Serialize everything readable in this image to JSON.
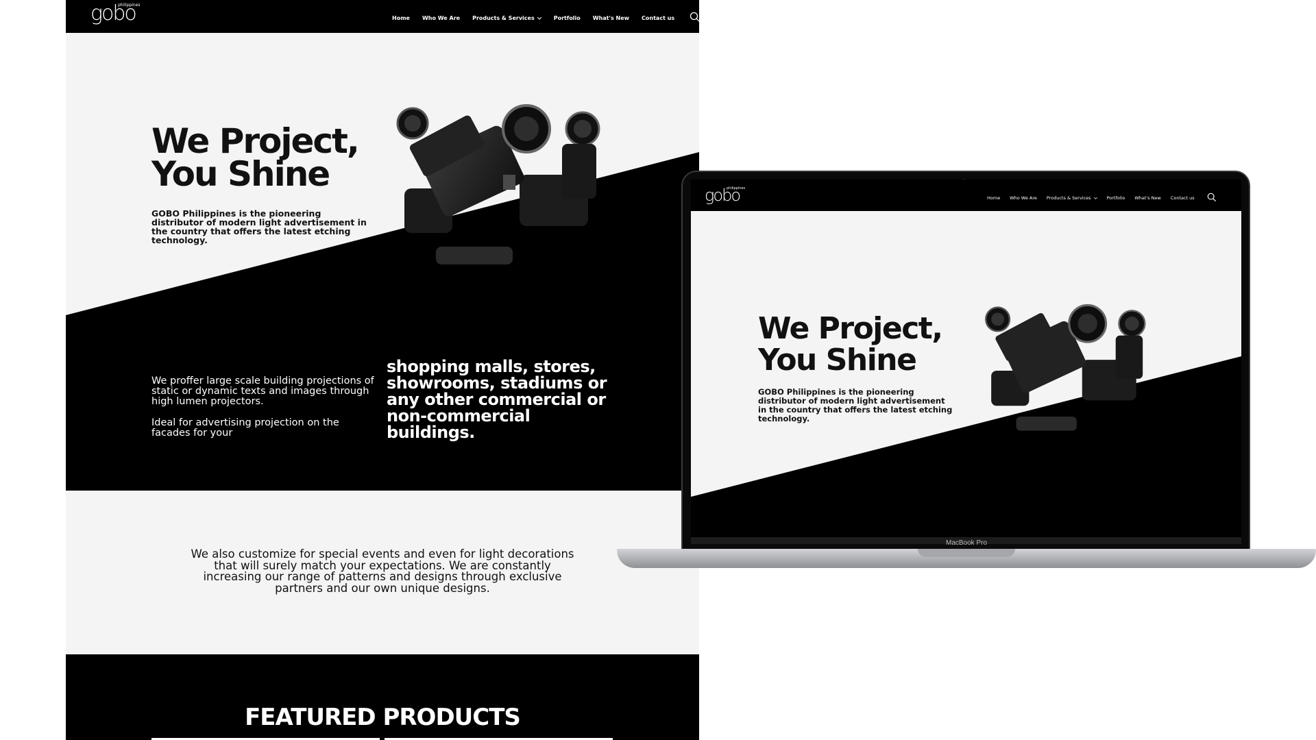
{
  "site": {
    "logo_text": "gobo",
    "logo_sub": "philippines",
    "nav": [
      "Home",
      "Who We Are",
      "Products & Services",
      "Portfolio",
      "What's New",
      "Contact us"
    ]
  },
  "hero": {
    "title_line1": "We Project,",
    "title_line2": "You Shine",
    "description": "GOBO Philippines is the pioneering distributor of modern light advertisement in the country that offers the latest etching technology."
  },
  "projection": {
    "para1": "We proffer large scale building projections of static or dynamic texts and images through high lumen projectors.",
    "para2": "Ideal for advertising projection on the facades for your",
    "highlight": "shopping malls, stores, showrooms, stadiums or any other commercial or non-commercial buildings."
  },
  "custom": {
    "text": "We also customize for special events and even for light decorations that will surely match your expectations. We are constantly increasing our range of patterns and designs through exclusive partners and our own unique designs."
  },
  "featured": {
    "title": "FEATURED PRODUCTS"
  },
  "laptop": {
    "brand": "MacBook Pro"
  },
  "colors": {
    "black": "#000000",
    "light_bg": "#f4f4f4",
    "white": "#ffffff"
  },
  "icons": [
    "search-icon",
    "chevron-down-icon"
  ]
}
